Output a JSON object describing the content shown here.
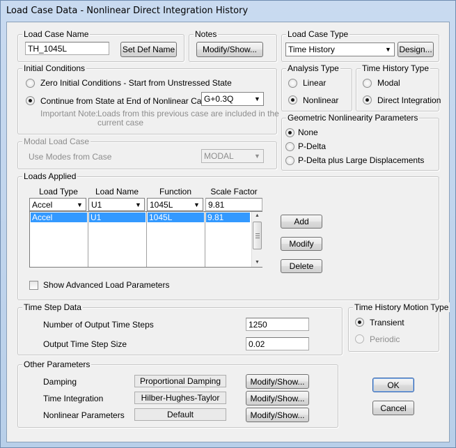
{
  "window": {
    "title": "Load Case Data - Nonlinear Direct Integration History"
  },
  "load_case_name": {
    "legend": "Load Case Name",
    "value": "TH_1045L",
    "set_def_label": "Set Def Name"
  },
  "notes": {
    "legend": "Notes",
    "button": "Modify/Show..."
  },
  "load_case_type": {
    "legend": "Load Case Type",
    "selected": "Time History",
    "design_button": "Design..."
  },
  "initial_conditions": {
    "legend": "Initial Conditions",
    "option_zero": "Zero Initial Conditions - Start from Unstressed State",
    "option_continue": "Continue from State at End of Nonlinear Case",
    "continue_case": "G+0.3Q",
    "note_label": "Important Note:",
    "note_line1": "Loads from this previous case are included in the",
    "note_line2": "current case"
  },
  "analysis_type": {
    "legend": "Analysis Type",
    "linear": "Linear",
    "nonlinear": "Nonlinear"
  },
  "time_history_type": {
    "legend": "Time History Type",
    "modal": "Modal",
    "direct": "Direct Integration"
  },
  "geometric_nonlinearity": {
    "legend": "Geometric Nonlinearity Parameters",
    "none": "None",
    "pdelta": "P-Delta",
    "pdelta_large": "P-Delta plus Large Displacements"
  },
  "modal_load_case": {
    "legend": "Modal Load Case",
    "label": "Use Modes from Case",
    "value": "MODAL"
  },
  "loads_applied": {
    "legend": "Loads Applied",
    "headers": {
      "load_type": "Load Type",
      "load_name": "Load Name",
      "function": "Function",
      "scale_factor": "Scale Factor"
    },
    "edit_row": {
      "load_type": "Accel",
      "load_name": "U1",
      "function": "1045L",
      "scale_factor": "9.81"
    },
    "rows": [
      {
        "load_type": "Accel",
        "load_name": "U1",
        "function": "1045L",
        "scale_factor": "9.81"
      }
    ],
    "add": "Add",
    "modify": "Modify",
    "delete": "Delete",
    "show_advanced": "Show Advanced Load Parameters"
  },
  "time_step_data": {
    "legend": "Time Step Data",
    "steps_label": "Number of Output Time Steps",
    "steps_value": "1250",
    "size_label": "Output Time Step Size",
    "size_value": "0.02"
  },
  "motion_type": {
    "legend": "Time History Motion Type",
    "transient": "Transient",
    "periodic": "Periodic"
  },
  "other_parameters": {
    "legend": "Other Parameters",
    "damping_label": "Damping",
    "damping_value": "Proportional Damping",
    "integration_label": "Time Integration",
    "integration_value": "Hilber-Hughes-Taylor",
    "nonlinear_label": "Nonlinear Parameters",
    "nonlinear_value": "Default",
    "modify_show": "Modify/Show..."
  },
  "dialog": {
    "ok": "OK",
    "cancel": "Cancel"
  }
}
